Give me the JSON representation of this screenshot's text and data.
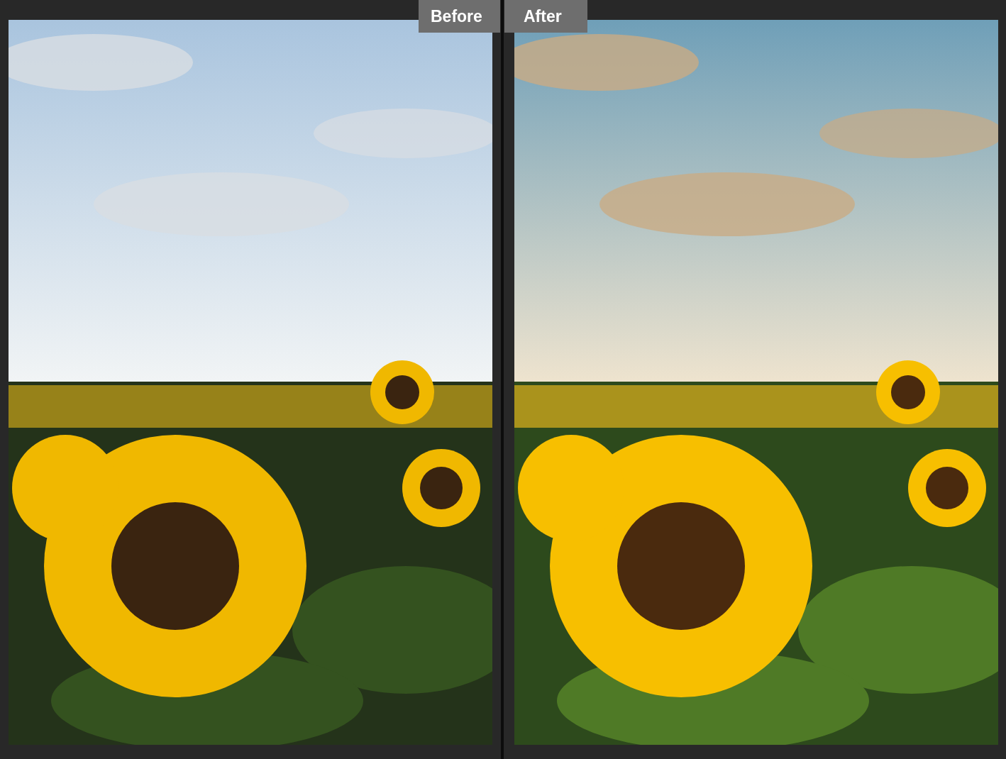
{
  "panels": [
    {
      "label": "Before"
    },
    {
      "label": "After"
    }
  ]
}
